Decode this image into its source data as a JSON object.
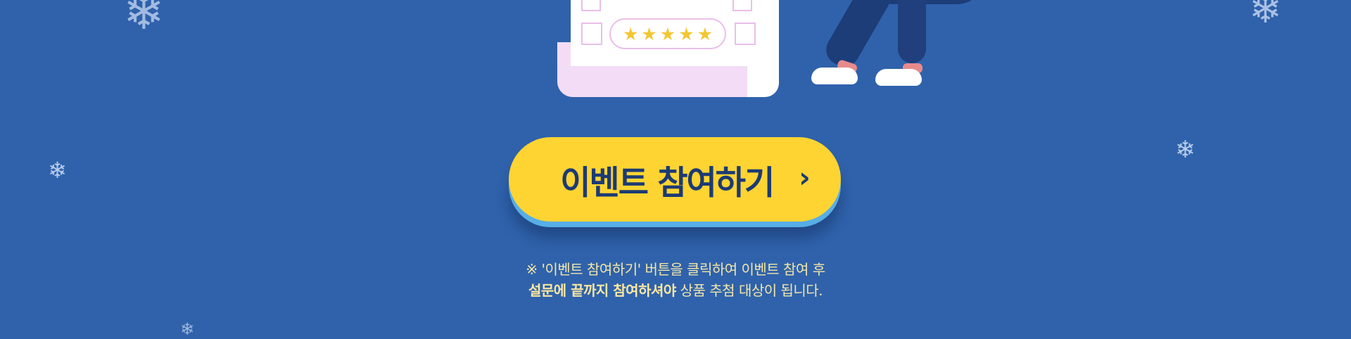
{
  "button": {
    "label": "이벤트 참여하기",
    "arrow": "›"
  },
  "notice": {
    "line1": "※ '이벤트 참여하기' 버튼을 클릭하여 이벤트 참여 후",
    "line2_bold": "설문에 끝까지 참여하셔야",
    "line2_rest": " 상품 추첨 대상이 됩니다."
  },
  "survey_card": {
    "rating_stars": 5
  },
  "icons": {
    "snowflake": "snowflake-icon",
    "star": "star-icon",
    "checkbox_marked": "x-mark-icon",
    "button_arrow": "chevron-right-icon"
  },
  "colors": {
    "background": "#2f62ab",
    "button": "#fdd432",
    "button_shadow": "#57aee6",
    "button_text": "#1c3a74",
    "notice_text": "#f4e6a8"
  }
}
